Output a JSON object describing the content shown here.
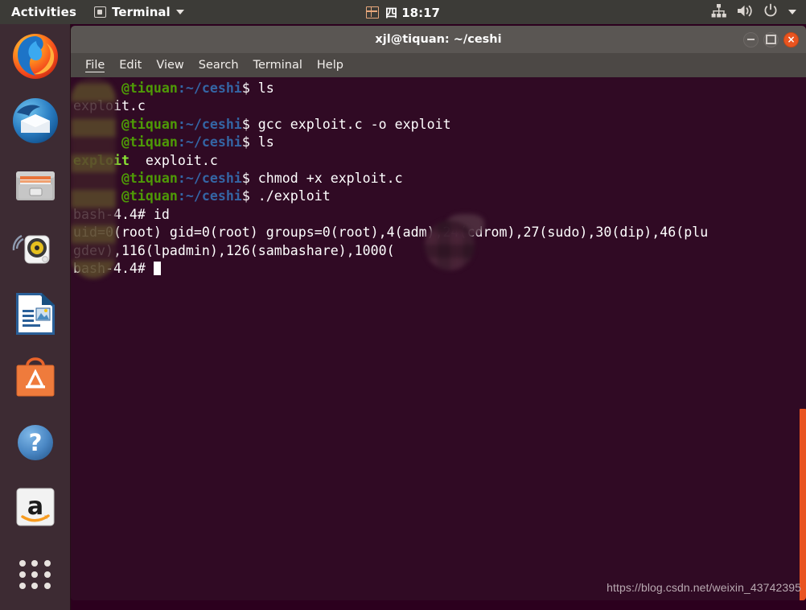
{
  "top_panel": {
    "activities_label": "Activities",
    "app_menu_label": "Terminal",
    "clock": "四 18:17",
    "icons": {
      "app": "terminal-window-icon",
      "caret": "chevron-down-icon",
      "calendar": "calendar-icon",
      "network": "wired-network-icon",
      "volume": "volume-icon",
      "power": "power-icon",
      "tray_caret": "chevron-down-icon"
    }
  },
  "dock": {
    "items": [
      {
        "name": "firefox",
        "label": "Firefox Web Browser"
      },
      {
        "name": "thunderbird",
        "label": "Thunderbird Mail"
      },
      {
        "name": "files",
        "label": "Files"
      },
      {
        "name": "rhythmbox",
        "label": "Rhythmbox"
      },
      {
        "name": "libreoffice-writer",
        "label": "LibreOffice Writer"
      },
      {
        "name": "ubuntu-software",
        "label": "Ubuntu Software"
      },
      {
        "name": "help",
        "label": "Help"
      },
      {
        "name": "amazon",
        "label": "Amazon"
      },
      {
        "name": "show-applications",
        "label": "Show Applications"
      }
    ]
  },
  "terminal": {
    "title": "xjl@tiquan: ~/ceshi",
    "menu": [
      {
        "label": "File",
        "mnemonic": true
      },
      {
        "label": "Edit",
        "mnemonic": false
      },
      {
        "label": "View",
        "mnemonic": false
      },
      {
        "label": "Search",
        "mnemonic": false
      },
      {
        "label": "Terminal",
        "mnemonic": false
      },
      {
        "label": "Help",
        "mnemonic": false
      }
    ],
    "window_controls": {
      "minimize": "minimize-button",
      "maximize": "maximize-button",
      "close": "×"
    },
    "prompt_host": "@tiquan",
    "prompt_path": ":~/ceshi",
    "prompt_sigil": "$ ",
    "lines": [
      {
        "type": "prompt",
        "command": "ls"
      },
      {
        "type": "output",
        "text": "exploit.c"
      },
      {
        "type": "prompt",
        "command": "gcc exploit.c -o exploit"
      },
      {
        "type": "prompt",
        "command": "ls"
      },
      {
        "type": "output-ls",
        "exec": "exploit",
        "file": "exploit.c"
      },
      {
        "type": "prompt",
        "command": "chmod +x exploit.c"
      },
      {
        "type": "prompt",
        "command": "./exploit"
      },
      {
        "type": "root",
        "prompt": "bash-4.4# ",
        "command": "id"
      },
      {
        "type": "output",
        "text": "uid=0(root) gid=0(root) groups=0(root),4(adm),24(cdrom),27(sudo),30(dip),46(plu"
      },
      {
        "type": "output",
        "text": "gdev),116(lpadmin),126(sambashare),1000("
      },
      {
        "type": "root-cursor",
        "prompt": "bash-4.4# "
      }
    ],
    "watermark": "https://blog.csdn.net/weixin_43742395"
  },
  "colors": {
    "terminal_bg": "#300a24",
    "titlebar_bg": "#5a5653",
    "menubar_bg": "#4c4845",
    "dock_bg": "#3d2b33",
    "panel_bg": "#3c3b37",
    "accent_orange": "#e95420",
    "prompt_green": "#4e9a06",
    "prompt_blue": "#3465a4",
    "exec_green": "#8ae234"
  }
}
